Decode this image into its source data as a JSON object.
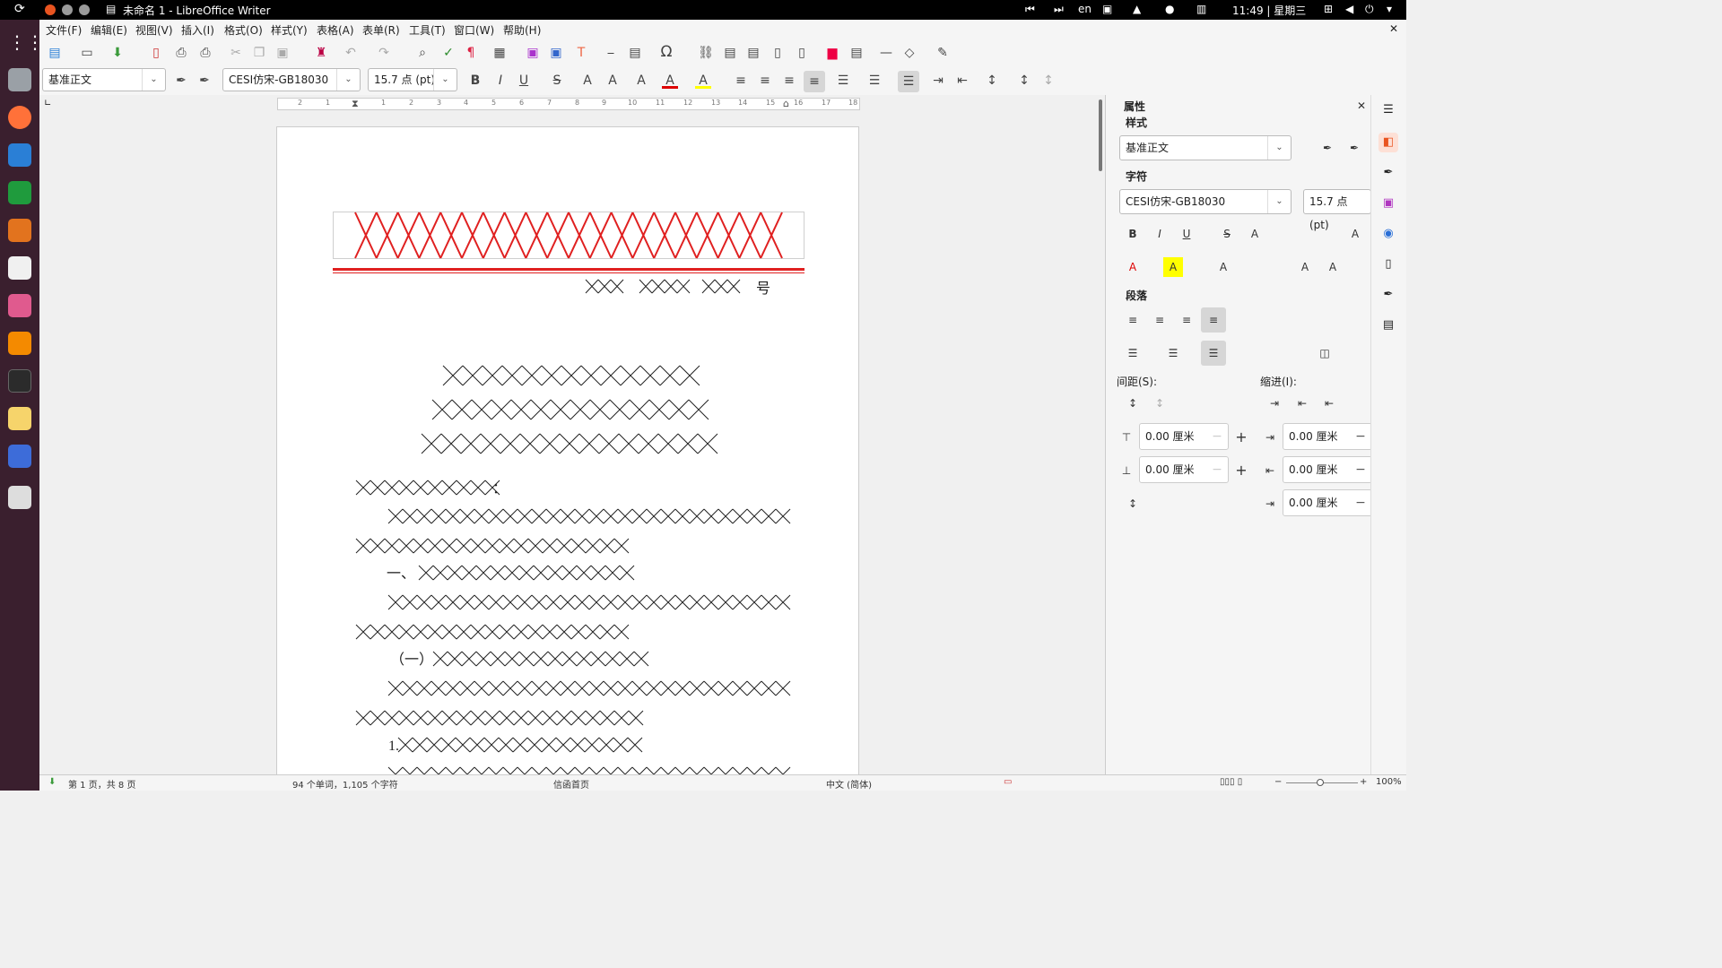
{
  "topbar": {
    "window_title": "未命名 1 - LibreOffice Writer",
    "input_lang": "en",
    "clock": "11:49 | 星期三"
  },
  "menu": [
    "文件(F)",
    "编辑(E)",
    "视图(V)",
    "插入(I)",
    "格式(O)",
    "样式(Y)",
    "表格(A)",
    "表单(R)",
    "工具(T)",
    "窗口(W)",
    "帮助(H)"
  ],
  "toolbar": {
    "para_style": "基准正文",
    "font_name": "CESI仿宋-GB18030",
    "font_size": "15.7 点 (pt)"
  },
  "ruler_numbers": [
    "2",
    "1",
    "1",
    "2",
    "3",
    "4",
    "5",
    "6",
    "7",
    "8",
    "9",
    "10",
    "11",
    "12",
    "13",
    "14",
    "15",
    "16",
    "17",
    "18"
  ],
  "document": {
    "doc_number_suffix": "号",
    "salutation_colon": "：",
    "section_one": "一、",
    "subsection_one": "（一）",
    "item_one": "1."
  },
  "sidebar": {
    "title": "属性",
    "style_section": "样式",
    "style_value": "基准正文",
    "char_section": "字符",
    "char_font": "CESI仿宋-GB18030",
    "char_size": "15.7 点 (pt)",
    "para_section": "段落",
    "spacing_label": "间距(S):",
    "indent_label": "缩进(I):",
    "spacing_above": "0.00 厘米",
    "spacing_below": "0.00 厘米",
    "indent_before": "0.00 厘米",
    "indent_after": "0.00 厘米",
    "indent_first": "0.00 厘米"
  },
  "statusbar": {
    "page": "第 1 页，共 8 页",
    "words": "94 个单词，1,105 个字符",
    "page_style": "信函首页",
    "language": "中文 (简体)",
    "zoom": "100%"
  },
  "colors": {
    "accent_red": "#e02020",
    "orange": "#e95420"
  }
}
